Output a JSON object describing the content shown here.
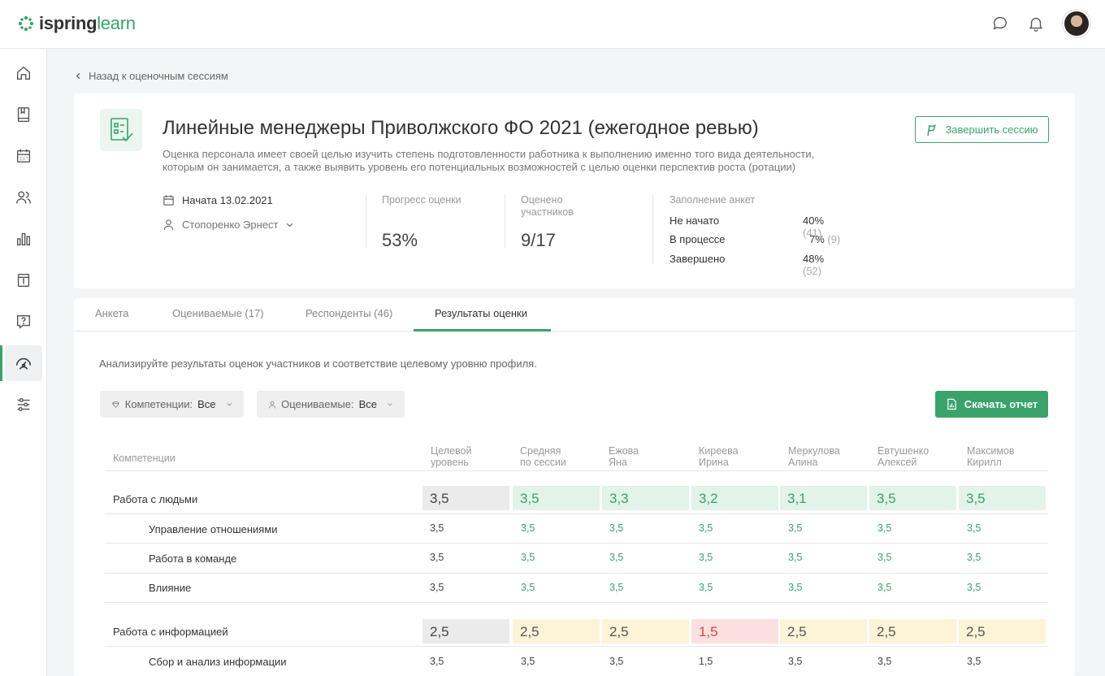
{
  "app": {
    "logo_part1": "ispring",
    "logo_part2": "learn"
  },
  "back_link": "Назад к оценочным сессиям",
  "session": {
    "title": "Линейные менеджеры Приволжского ФО 2021 (ежегодное ревью)",
    "description": "Оценка персонала имеет своей целью изучить степень подготовленности работника к выполнению именно того вида деятельности, которым он занимается, а также выявить уровень его потенциальных возможностей с целью оценки перспектив роста (ротации)",
    "finish_button": "Завершить сессию",
    "start_date": "Начата 13.02.2021",
    "owner": "Стопоренко Эрнест",
    "progress_label": "Прогресс оценки",
    "progress_value": "53%",
    "evaluated_label": "Оценено участников",
    "evaluated_value": "9/17",
    "forms_label": "Заполнение анкет",
    "forms": [
      {
        "label": "Не начато",
        "pct": "40%",
        "count": "(41)"
      },
      {
        "label": "В процессе",
        "pct": "7%",
        "count": "(9)"
      },
      {
        "label": "Завершено",
        "pct": "48%",
        "count": "(52)"
      }
    ]
  },
  "tabs": [
    "Анкета",
    "Оцениваемые (17)",
    "Респонденты (46)",
    "Результаты оценки"
  ],
  "active_tab": "Результаты оценки",
  "results": {
    "hint": "Анализируйте результаты оценок участников и соответствие целевому уровню профиля.",
    "filter_competencies_label": "Компетенции:",
    "filter_competencies_value": "Все",
    "filter_evaluated_label": "Оцениваемые:",
    "filter_evaluated_value": "Все",
    "download_button": "Скачать отчет",
    "columns": {
      "competencies": "Компетенции",
      "c1a": "Целевой",
      "c1b": "уровень",
      "c2a": "Средняя",
      "c2b": "по сессии",
      "c3a": "Ежова",
      "c3b": "Яна",
      "c4a": "Киреева",
      "c4b": "Ирина",
      "c5a": "Меркулова",
      "c5b": "Алина",
      "c6a": "Евтушенко",
      "c6b": "Алексей",
      "c7a": "Максимов",
      "c7b": "Кирилл"
    },
    "groups": [
      {
        "name": "Работа с людьми",
        "values": [
          "3,5",
          "3,5",
          "3,3",
          "3,2",
          "3,1",
          "3,5",
          "3,5"
        ],
        "status": [
          "target",
          "good",
          "good",
          "good",
          "good",
          "good",
          "good"
        ],
        "items": [
          {
            "name": "Управление отношениями",
            "values": [
              "3,5",
              "3,5",
              "3,5",
              "3,5",
              "3,5",
              "3,5",
              "3,5"
            ]
          },
          {
            "name": "Работа в команде",
            "values": [
              "3,5",
              "3,5",
              "3,5",
              "3,5",
              "3,5",
              "3,5",
              "3,5"
            ]
          },
          {
            "name": "Влияние",
            "values": [
              "3,5",
              "3,5",
              "3,5",
              "3,5",
              "3,5",
              "3,5",
              "3,5"
            ]
          }
        ]
      },
      {
        "name": "Работа с информацией",
        "values": [
          "2,5",
          "2,5",
          "2,5",
          "1,5",
          "2,5",
          "2,5",
          "2,5"
        ],
        "status": [
          "target",
          "warn",
          "warn",
          "bad",
          "warn",
          "warn",
          "warn"
        ],
        "items": [
          {
            "name": "Сбор и анализ информации",
            "values": [
              "3,5",
              "3,5",
              "3,5",
              "1,5",
              "3,5",
              "3,5",
              "3,5"
            ]
          }
        ]
      }
    ]
  },
  "colors": {
    "accent": "#3aa36a",
    "good_bg": "#e2f3e9",
    "warn_bg": "#fdf3d6",
    "bad_bg": "#fbe0e0",
    "bad_text": "#d94545"
  },
  "icons": {
    "sidebar": [
      "home-icon",
      "book-icon",
      "calendar-icon",
      "users-icon",
      "bar-chart-icon",
      "info-box-icon",
      "question-icon",
      "gauge-icon",
      "settings-sliders-icon"
    ],
    "top": [
      "chat-icon",
      "bell-icon"
    ]
  }
}
